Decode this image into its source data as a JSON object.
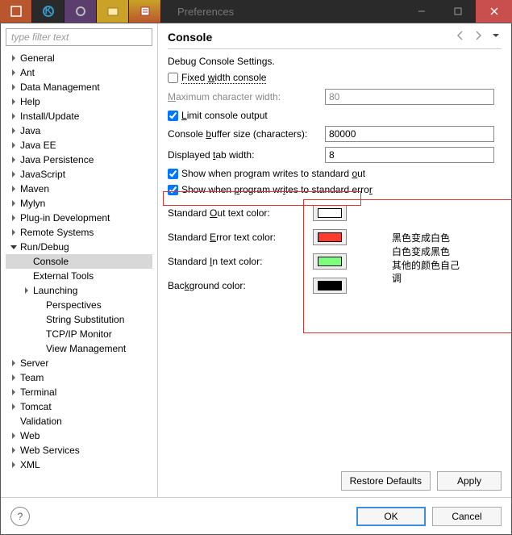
{
  "window": {
    "title": "Preferences"
  },
  "filter": {
    "placeholder": "type filter text"
  },
  "tree": [
    {
      "label": "General",
      "lvl": 0,
      "tw": "closed"
    },
    {
      "label": "Ant",
      "lvl": 0,
      "tw": "closed"
    },
    {
      "label": "Data Management",
      "lvl": 0,
      "tw": "closed"
    },
    {
      "label": "Help",
      "lvl": 0,
      "tw": "closed"
    },
    {
      "label": "Install/Update",
      "lvl": 0,
      "tw": "closed"
    },
    {
      "label": "Java",
      "lvl": 0,
      "tw": "closed"
    },
    {
      "label": "Java EE",
      "lvl": 0,
      "tw": "closed"
    },
    {
      "label": "Java Persistence",
      "lvl": 0,
      "tw": "closed"
    },
    {
      "label": "JavaScript",
      "lvl": 0,
      "tw": "closed"
    },
    {
      "label": "Maven",
      "lvl": 0,
      "tw": "closed"
    },
    {
      "label": "Mylyn",
      "lvl": 0,
      "tw": "closed"
    },
    {
      "label": "Plug-in Development",
      "lvl": 0,
      "tw": "closed"
    },
    {
      "label": "Remote Systems",
      "lvl": 0,
      "tw": "closed"
    },
    {
      "label": "Run/Debug",
      "lvl": 0,
      "tw": "open"
    },
    {
      "label": "Console",
      "lvl": 1,
      "tw": "none",
      "sel": true
    },
    {
      "label": "External Tools",
      "lvl": 1,
      "tw": "none"
    },
    {
      "label": "Launching",
      "lvl": 1,
      "tw": "closed",
      "indent2": true
    },
    {
      "label": "Perspectives",
      "lvl": 2,
      "tw": "none"
    },
    {
      "label": "String Substitution",
      "lvl": 2,
      "tw": "none"
    },
    {
      "label": "TCP/IP Monitor",
      "lvl": 2,
      "tw": "none"
    },
    {
      "label": "View Management",
      "lvl": 2,
      "tw": "none"
    },
    {
      "label": "Server",
      "lvl": 0,
      "tw": "closed"
    },
    {
      "label": "Team",
      "lvl": 0,
      "tw": "closed"
    },
    {
      "label": "Terminal",
      "lvl": 0,
      "tw": "closed"
    },
    {
      "label": "Tomcat",
      "lvl": 0,
      "tw": "closed"
    },
    {
      "label": "Validation",
      "lvl": 0,
      "tw": "none"
    },
    {
      "label": "Web",
      "lvl": 0,
      "tw": "closed"
    },
    {
      "label": "Web Services",
      "lvl": 0,
      "tw": "closed"
    },
    {
      "label": "XML",
      "lvl": 0,
      "tw": "closed"
    }
  ],
  "page": {
    "title": "Console",
    "desc": "Debug Console Settings.",
    "fixed_width_label": "Fixed width console",
    "max_width_label": "Maximum character width:",
    "max_width_value": "80",
    "limit_label": "Limit console output",
    "buffer_label": "Console buffer size (characters):",
    "buffer_value": "80000",
    "tab_label": "Displayed tab width:",
    "tab_value": "8",
    "show_stdout": "Show when program writes to standard out",
    "show_stderr": "Show when program writes to standard error",
    "color_out": "Standard Out text color:",
    "color_err": "Standard Error text color:",
    "color_in": "Standard In text color:",
    "color_bg": "Background color:",
    "colors": {
      "out": "#ffffff",
      "err": "#ff3b30",
      "in": "#7cff7c",
      "bg": "#000000"
    }
  },
  "annotation": {
    "l1": "黑色变成白色",
    "l2": "白色变成黑色",
    "l3": "其他的颜色自己",
    "l4": "调"
  },
  "buttons": {
    "restore": "Restore Defaults",
    "apply": "Apply",
    "ok": "OK",
    "cancel": "Cancel"
  }
}
